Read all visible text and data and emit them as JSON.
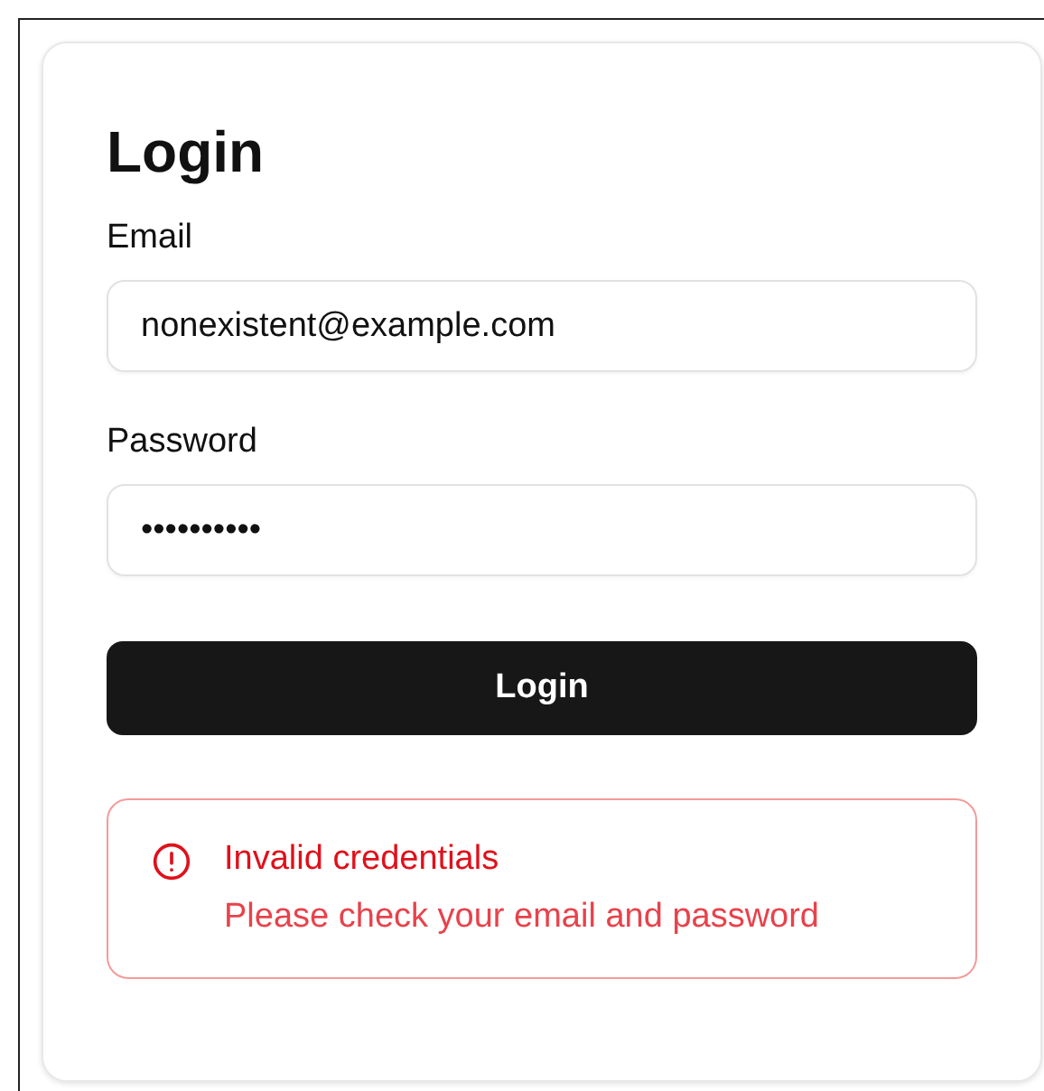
{
  "title": "Login",
  "fields": [
    {
      "label": "Email",
      "value": "nonexistent@example.com"
    },
    {
      "label": "Password",
      "value": "••••••••••"
    }
  ],
  "button": "Login",
  "alert": {
    "title": "Invalid credentials",
    "message": "Please check your email and password"
  }
}
